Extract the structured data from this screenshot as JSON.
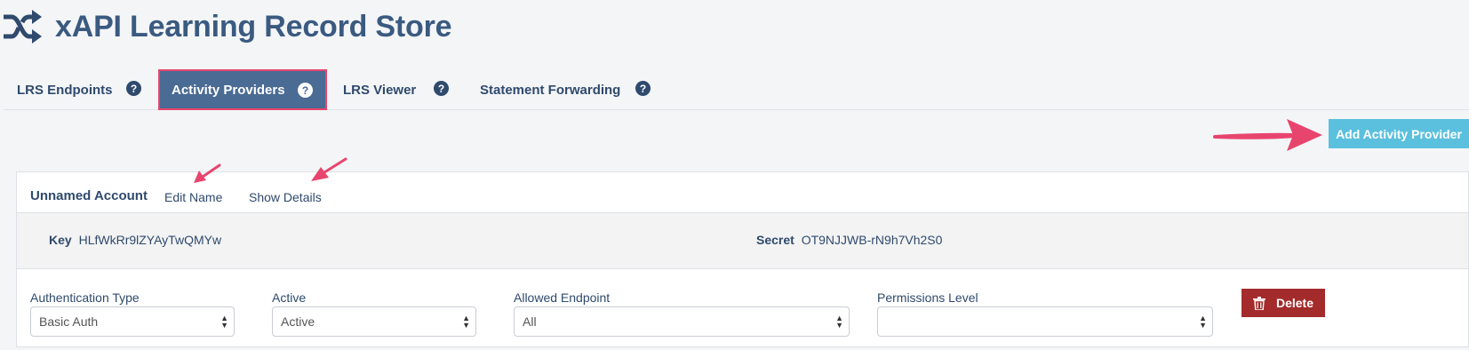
{
  "app": {
    "title": "xAPI Learning Record Store",
    "logo_icon": "shuffle-icon"
  },
  "tabs": [
    {
      "label": "LRS Endpoints",
      "help": "?",
      "active": false
    },
    {
      "label": "Activity Providers",
      "help": "?",
      "active": true
    },
    {
      "label": "LRS Viewer",
      "help": "?",
      "active": false
    },
    {
      "label": "Statement Forwarding",
      "help": "?",
      "active": false
    }
  ],
  "toolbar": {
    "add_label": "Add Activity Provider"
  },
  "account": {
    "name": "Unnamed Account",
    "edit_name_label": "Edit Name",
    "show_details_label": "Show Details",
    "key_label": "Key",
    "key_value": "HLfWkRr9lZYAyTwQMYw",
    "secret_label": "Secret",
    "secret_value": "OT9NJJWB-rN9h7Vh2S0"
  },
  "fields": {
    "auth_type": {
      "label": "Authentication Type",
      "value": "Basic Auth"
    },
    "active": {
      "label": "Active",
      "value": "Active"
    },
    "allowed_endpoint": {
      "label": "Allowed Endpoint",
      "value": "All"
    },
    "permissions": {
      "label": "Permissions Level",
      "value": ""
    }
  },
  "delete_label": "Delete",
  "colors": {
    "brand": "#3a5a80",
    "active_tab": "#4a6b93",
    "highlight": "#e8456e",
    "add_button": "#5bc0de",
    "delete_button": "#a32b2b"
  }
}
